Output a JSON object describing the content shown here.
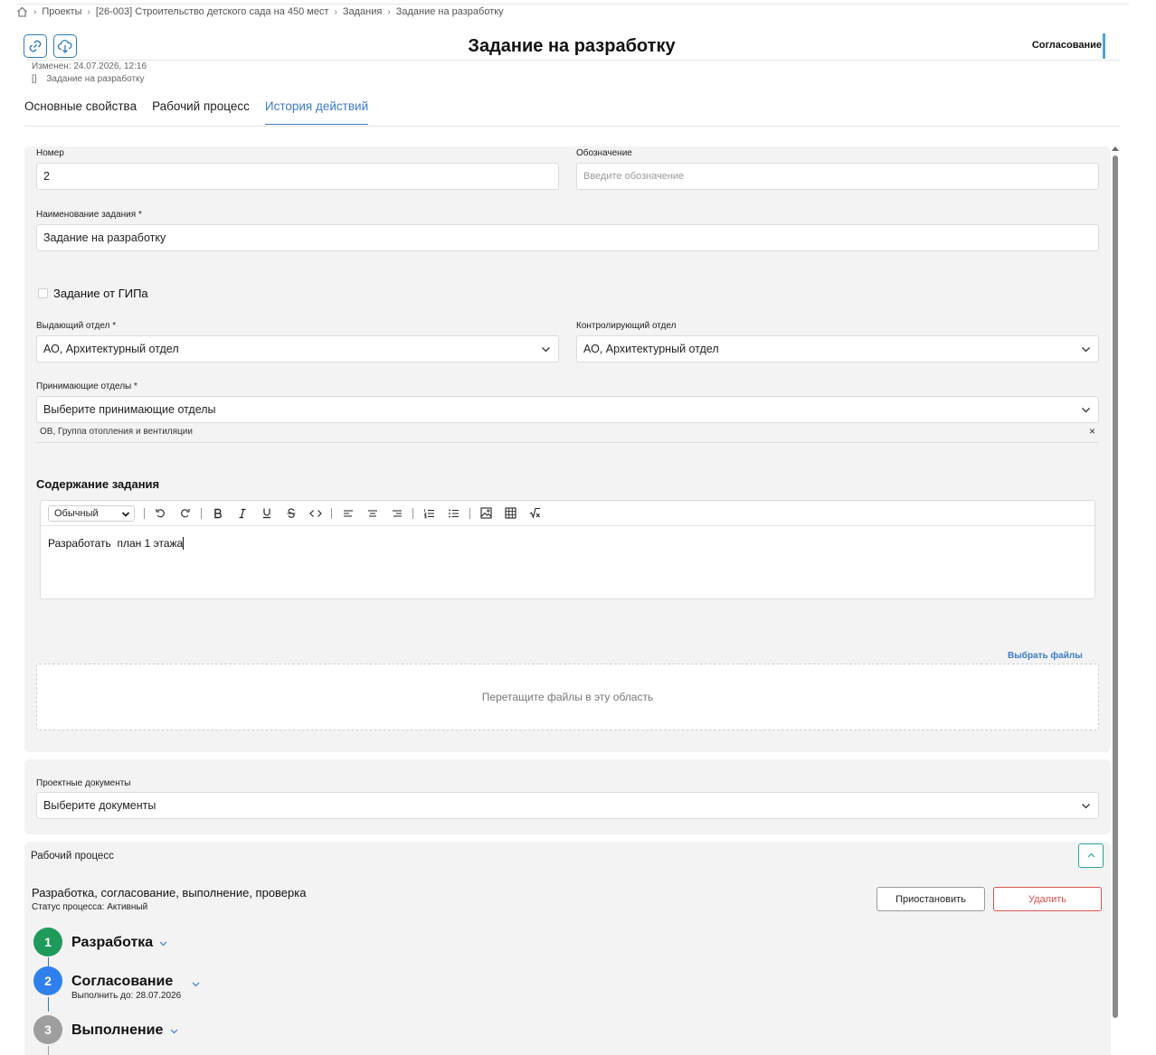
{
  "breadcrumb": {
    "items": [
      "Проекты",
      "[26-003] Строительство детского сада на 450 мест",
      "Задания",
      "Задание на разработку"
    ]
  },
  "header": {
    "title": "Задание на разработку",
    "status": "Согласование",
    "modified": "Изменен: 24.07.2026, 12:16",
    "doc_ref": "Задание на разработку",
    "doc_ref_bracket": "[]"
  },
  "tabs": [
    {
      "label": "Основные свойства",
      "active": false
    },
    {
      "label": "Рабочий процесс",
      "active": false
    },
    {
      "label": "История действий",
      "active": true
    }
  ],
  "form": {
    "number_label": "Номер",
    "number_value": "2",
    "designation_label": "Обозначение",
    "designation_placeholder": "Введите обозначение",
    "name_label": "Наименование задания *",
    "name_value": "Задание на разработку",
    "gip_label": "Задание от ГИПа",
    "issuing_label": "Выдающий отдел *",
    "issuing_value": "АО, Архитектурный отдел",
    "control_label": "Контролирующий отдел",
    "control_value": "АО, Архитектурный отдел",
    "receiving_label": "Принимающие отделы *",
    "receiving_placeholder": "Выберите принимающие отделы",
    "receiving_tag": "ОВ, Группа отопления и вентиляции",
    "tag_remove": "×",
    "content_title": "Содержание задания",
    "editor_format": "Обычный",
    "editor_text": "Разработать  план 1 этажа",
    "choose_files": "Выбрать файлы",
    "dropzone_text": "Перетащите файлы в эту область"
  },
  "docs": {
    "label": "Проектные документы",
    "placeholder": "Выберите документы"
  },
  "workflow": {
    "section_label": "Рабочий процесс",
    "name": "Разработка, согласование, выполнение, проверка",
    "status": "Статус процесса: Активный",
    "pause_label": "Приостановить",
    "delete_label": "Удалить",
    "steps": [
      {
        "num": "1",
        "title": "Разработка",
        "sub": "",
        "color": "#1e9a5a"
      },
      {
        "num": "2",
        "title": "Согласование",
        "sub": "Выполнить до: 28.07.2026",
        "color": "#2f80ed"
      },
      {
        "num": "3",
        "title": "Выполнение",
        "sub": "",
        "color": "#9e9e9e"
      }
    ]
  },
  "colors": {
    "accent": "#3a7bc8",
    "danger": "#d9534f",
    "teal": "#2aa39a"
  }
}
